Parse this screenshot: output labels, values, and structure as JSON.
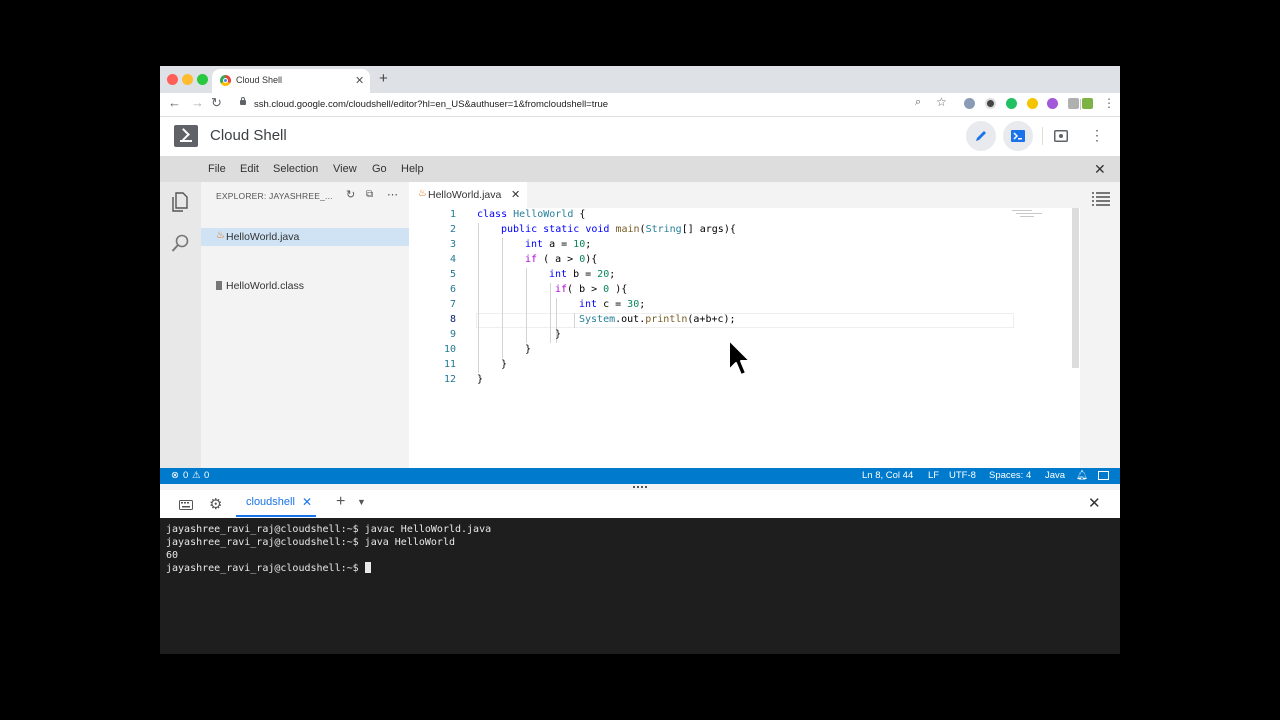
{
  "browser": {
    "tab_title": "Cloud Shell",
    "url": "ssh.cloud.google.com/cloudshell/editor?hl=en_US&authuser=1&fromcloudshell=true"
  },
  "app": {
    "title": "Cloud Shell"
  },
  "menu": [
    "File",
    "Edit",
    "Selection",
    "View",
    "Go",
    "Help"
  ],
  "explorer": {
    "title": "EXPLORER: JAYASHREE_...",
    "files": [
      "HelloWorld.class",
      "HelloWorld.java"
    ],
    "active_file": "HelloWorld.java"
  },
  "editor": {
    "tab_label": "HelloWorld.java",
    "line_numbers": [
      "1",
      "2",
      "3",
      "4",
      "5",
      "6",
      "7",
      "8",
      "9",
      "10",
      "11",
      "12"
    ],
    "lines": [
      "class HelloWorld {",
      "public static void main(String[] args){",
      "int a = 10;",
      "if ( a > 0){",
      "int b = 20;",
      "if( b > 0 ){",
      "int c = 30;",
      "System.out.println(a+b+c);",
      "}",
      "}",
      "}",
      "}"
    ]
  },
  "status": {
    "errors": "0",
    "warnings": "0",
    "position": "Ln 8, Col 44",
    "eol": "LF",
    "encoding": "UTF-8",
    "spaces": "Spaces: 4",
    "language": "Java"
  },
  "terminal": {
    "tab_label": "cloudshell",
    "lines": [
      "jayashree_ravi_raj@cloudshell:~$ javac HelloWorld.java",
      "jayashree_ravi_raj@cloudshell:~$ java HelloWorld",
      "60",
      "jayashree_ravi_raj@cloudshell:~$ "
    ]
  },
  "colors": {
    "status_bar": "#007acc",
    "accent": "#1a73e8",
    "terminal_bg": "#1e1e1e"
  }
}
